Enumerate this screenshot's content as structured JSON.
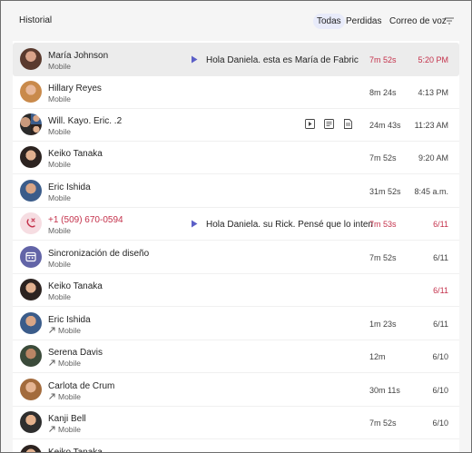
{
  "header": {
    "title": "Historial",
    "filters": {
      "all": "Todas",
      "missed": "Perdidas",
      "voicemail": "Correo de voz"
    },
    "filter_icon": "filter-icon"
  },
  "colors": {
    "accent": "#6264a7",
    "missed": "#c4314b",
    "selected_row": "#ececec",
    "pill": "#e8ebfa"
  },
  "calls": [
    {
      "name": "María Johnson",
      "sub": "Mobile",
      "voicemail": "Hola Daniela. esta es María de Fabric",
      "duration": "7m 52s",
      "time": "5:20 PM",
      "missed": true,
      "selected": true,
      "outgoing": false
    },
    {
      "name": "Hillary Reyes",
      "sub": "Mobile",
      "duration": "8m 24s",
      "time": "4:13 PM",
      "outgoing": false
    },
    {
      "name": "Will. Kayo. Eric. .2",
      "sub": "Mobile",
      "duration": "24m 43s",
      "time": "11:23 AM",
      "outgoing": false,
      "actions": [
        "play-icon",
        "transcript-icon",
        "notes-icon"
      ]
    },
    {
      "name": "Keiko Tanaka",
      "sub": "Mobile",
      "duration": "7m 52s",
      "time": "9:20 AM",
      "outgoing": false
    },
    {
      "name": "Eric Ishida",
      "sub": "Mobile",
      "duration": "31m 52s",
      "time": "8:45 a.m.",
      "outgoing": false
    },
    {
      "name": "+1 (509) 670-0594",
      "sub": "Mobile",
      "voicemail": "Hola Daniela. su Rick. Pensé que lo intentaría",
      "duration": "7m 53s",
      "time": "6/11",
      "missed": true,
      "outgoing": false
    },
    {
      "name": "Sincronización de diseño",
      "sub": "Mobile",
      "duration": "7m 52s",
      "time": "6/11",
      "outgoing": false
    },
    {
      "name": "Keiko Tanaka",
      "sub": "Mobile",
      "duration": "",
      "time": "6/11",
      "missed_time": true,
      "outgoing": false
    },
    {
      "name": "Eric Ishida",
      "sub": "Mobile",
      "duration": "1m 23s",
      "time": "6/11",
      "outgoing": true
    },
    {
      "name": "Serena Davis",
      "sub": "Mobile",
      "duration": "12m",
      "time": "6/10",
      "outgoing": true
    },
    {
      "name": "Carlota de Crum",
      "sub": "Mobile",
      "duration": "30m 11s",
      "time": "6/10",
      "outgoing": true
    },
    {
      "name": "Kanji Bell",
      "sub": "Mobile",
      "duration": "7m 52s",
      "time": "6/10",
      "outgoing": true
    },
    {
      "name": "Keiko Tanaka",
      "sub": "",
      "duration": "",
      "time": "",
      "outgoing": false
    }
  ]
}
